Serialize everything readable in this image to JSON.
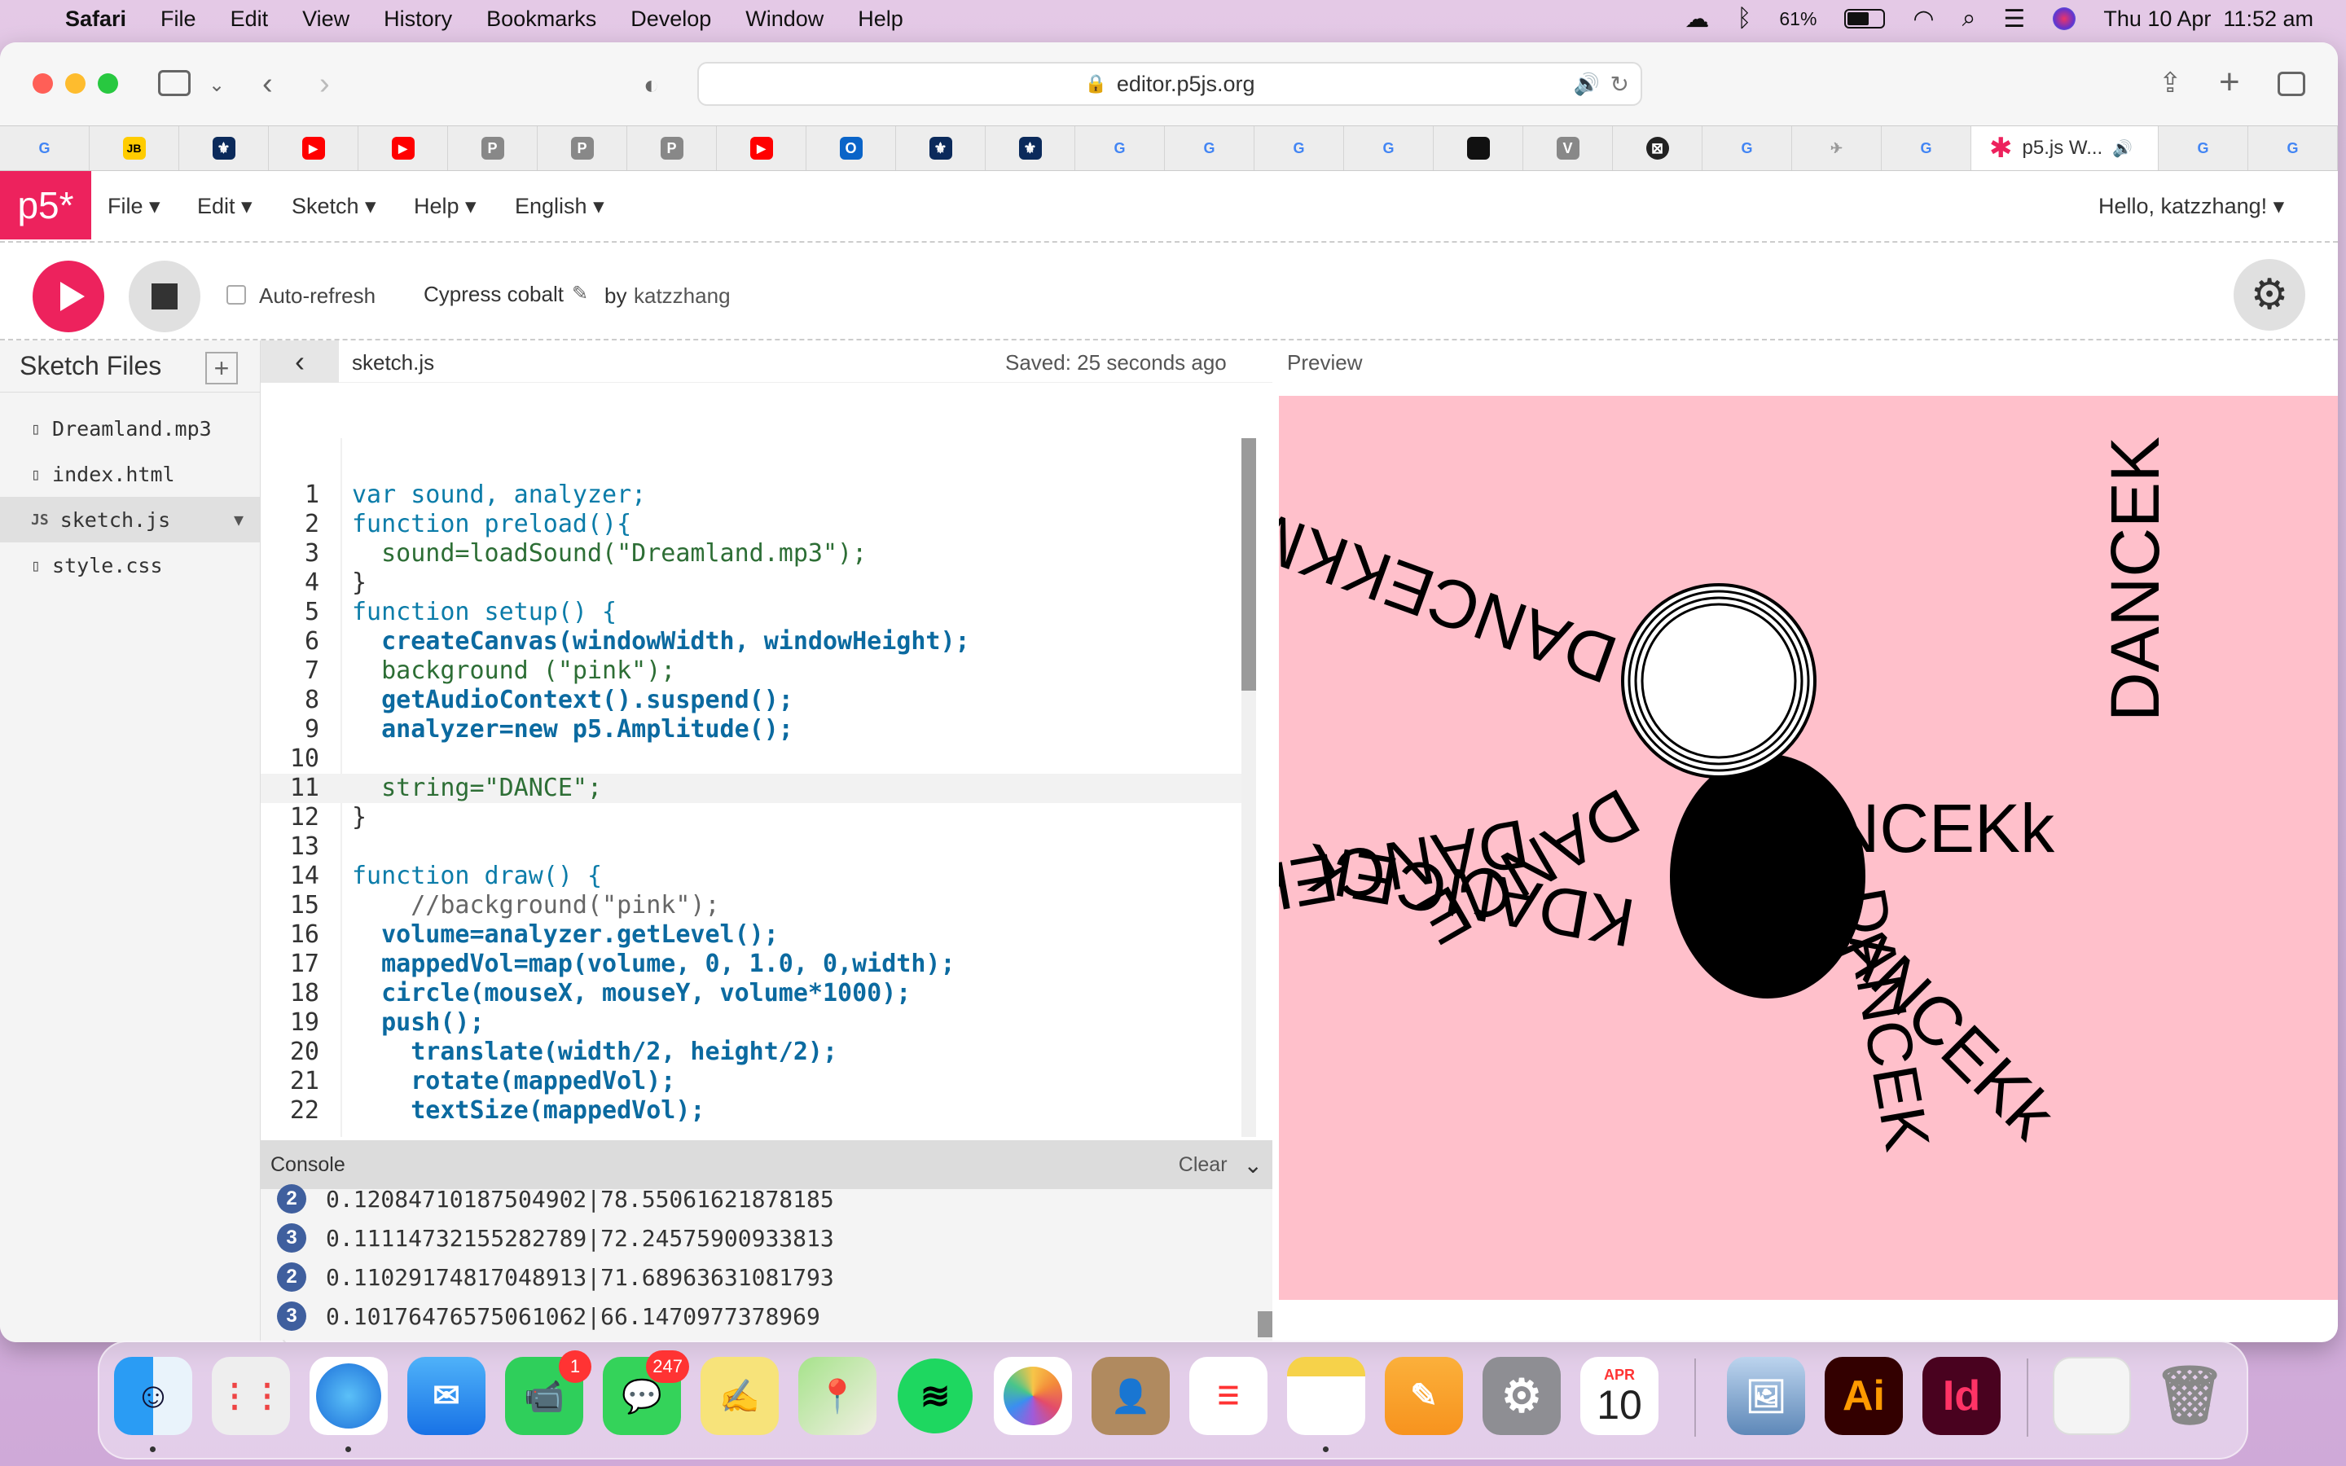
{
  "menubar": {
    "app": "Safari",
    "items": [
      "File",
      "Edit",
      "View",
      "History",
      "Bookmarks",
      "Develop",
      "Window",
      "Help"
    ],
    "battery_text": "61%",
    "battery_level": 0.61,
    "datetime": "Thu 10 Apr  11:52 am"
  },
  "browser": {
    "url": "editor.p5js.org",
    "active_tab_title": "p5.js W..."
  },
  "p5": {
    "logo": "p5*",
    "menu": [
      "File",
      "Edit",
      "Sketch",
      "Help",
      "English"
    ],
    "greeting": "Hello, katzzhang!",
    "auto_refresh_label": "Auto-refresh",
    "sketch_name": "Cypress cobalt",
    "by_label": "by",
    "author": "katzzhang",
    "sidebar_title": "Sketch Files",
    "files": [
      "Dreamland.mp3",
      "index.html",
      "sketch.js",
      "style.css"
    ],
    "open_file": "sketch.js",
    "saved_status": "Saved: 25 seconds ago",
    "preview_label": "Preview",
    "console_label": "Console",
    "console_clear": "Clear",
    "console_lines": [
      {
        "count": "2",
        "text": "0.12084710187504902|78.55061621878185"
      },
      {
        "count": "3",
        "text": "0.11114732155282789|72.24575900933813"
      },
      {
        "count": "2",
        "text": "0.11029174817048913|71.68963631081793"
      },
      {
        "count": "3",
        "text": "0.10176476575061062|66.1470977378969"
      }
    ],
    "preview_words": [
      "DANCEK",
      "DANCEKk",
      "DANCEKKMe",
      "DANCE",
      "DANCEKk"
    ],
    "code": [
      {
        "n": "1",
        "t": "var sound, analyzer;"
      },
      {
        "n": "2",
        "t": "function preload(){"
      },
      {
        "n": "3",
        "t": "  sound=loadSound(\"Dreamland.mp3\");"
      },
      {
        "n": "4",
        "t": "}"
      },
      {
        "n": "5",
        "t": "function setup() {"
      },
      {
        "n": "6",
        "t": "  createCanvas(windowWidth, windowHeight);"
      },
      {
        "n": "7",
        "t": "  background (\"pink\");"
      },
      {
        "n": "8",
        "t": "  getAudioContext().suspend();"
      },
      {
        "n": "9",
        "t": "  analyzer=new p5.Amplitude();"
      },
      {
        "n": "10",
        "t": ""
      },
      {
        "n": "11",
        "t": "  string=\"DANCE\";"
      },
      {
        "n": "12",
        "t": "}"
      },
      {
        "n": "13",
        "t": ""
      },
      {
        "n": "14",
        "t": "function draw() {"
      },
      {
        "n": "15",
        "t": "    //background(\"pink\");"
      },
      {
        "n": "16",
        "t": "  volume=analyzer.getLevel();"
      },
      {
        "n": "17",
        "t": "  mappedVol=map(volume, 0, 1.0, 0,width);"
      },
      {
        "n": "18",
        "t": "  circle(mouseX, mouseY, volume*1000);"
      },
      {
        "n": "19",
        "t": "  push();"
      },
      {
        "n": "20",
        "t": "    translate(width/2, height/2);"
      },
      {
        "n": "21",
        "t": "    rotate(mappedVol);"
      },
      {
        "n": "22",
        "t": "    textSize(mappedVol);"
      }
    ]
  },
  "dock": {
    "facetime_badge": "1",
    "messages_badge": "247",
    "calendar_month": "APR",
    "calendar_day": "10",
    "illustrator_label": "Ai",
    "indesign_label": "Id"
  },
  "colors": {
    "p5_pink": "#ed225d",
    "preview_bg": "#ffc0cb",
    "badge_blue": "#3f5f9e"
  }
}
